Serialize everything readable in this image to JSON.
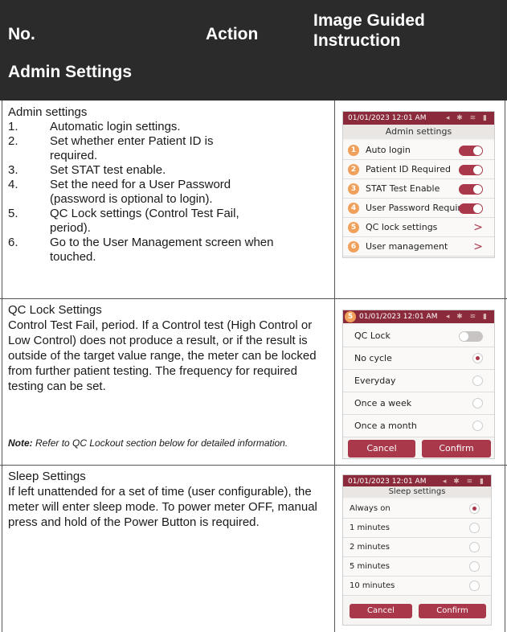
{
  "header": {
    "col_no": "No.",
    "col_action": "Action",
    "col_image": "Image Guided Instruction",
    "section": "Admin Settings"
  },
  "admin": {
    "intro": "Admin settings",
    "items": [
      {
        "num": "1.",
        "text": "Automatic login settings."
      },
      {
        "num": "2.",
        "text": "Set whether enter Patient ID is required."
      },
      {
        "num": "3.",
        "text": "Set STAT test enable."
      },
      {
        "num": "4.",
        "text": "Set the need for a User Password (password is optional to login)."
      },
      {
        "num": "5.",
        "text": "QC Lock settings (Control Test Fail, period)."
      },
      {
        "num": "6.",
        "text": "Go to the User Management screen when touched."
      }
    ],
    "screen": {
      "time": "01/01/2023 12:01 AM",
      "title": "Admin settings",
      "rows": [
        {
          "badge": "1",
          "label": "Auto login",
          "control": "toggle-on"
        },
        {
          "badge": "2",
          "label": "Patient ID Required",
          "control": "toggle-on"
        },
        {
          "badge": "3",
          "label": "STAT Test Enable",
          "control": "toggle-on"
        },
        {
          "badge": "4",
          "label": "User Password Required",
          "control": "toggle-on"
        },
        {
          "badge": "5",
          "label": "QC lock settings",
          "control": ">"
        },
        {
          "badge": "6",
          "label": "User management",
          "control": ">"
        }
      ]
    }
  },
  "qc": {
    "title": "QC Lock Settings",
    "body": "Control Test Fail, period. If a Control test (High Control or Low Control) does not produce a result, or if the result is outside of the target value range, the meter can be locked from further patient testing.  The frequency for required testing can be set.",
    "note_label": "Note:",
    "note_text": "Refer to QC Lockout section below for detailed information.",
    "screen": {
      "badge": "5",
      "time": "01/01/2023 12:01 AM",
      "rows": [
        "QC Lock",
        "No cycle",
        "Everyday",
        "Once a week",
        "Once a month"
      ],
      "cancel": "Cancel",
      "confirm": "Confirm"
    }
  },
  "sleep": {
    "title": "Sleep Settings",
    "body": "If left unattended for a set of time (user configurable), the meter will enter sleep mode. To power meter OFF, manual press and hold of the Power Button is required.",
    "screen": {
      "time": "01/01/2023 12:01 AM",
      "title": "Sleep settings",
      "rows": [
        "Always on",
        "1 minutes",
        "2 minutes",
        "5 minutes",
        "10 minutes"
      ],
      "cancel": "Cancel",
      "confirm": "Confirm"
    }
  },
  "colors": {
    "header_bg": "#2b2b2b",
    "accent": "#a8384a",
    "badge": "#f0a05a"
  }
}
